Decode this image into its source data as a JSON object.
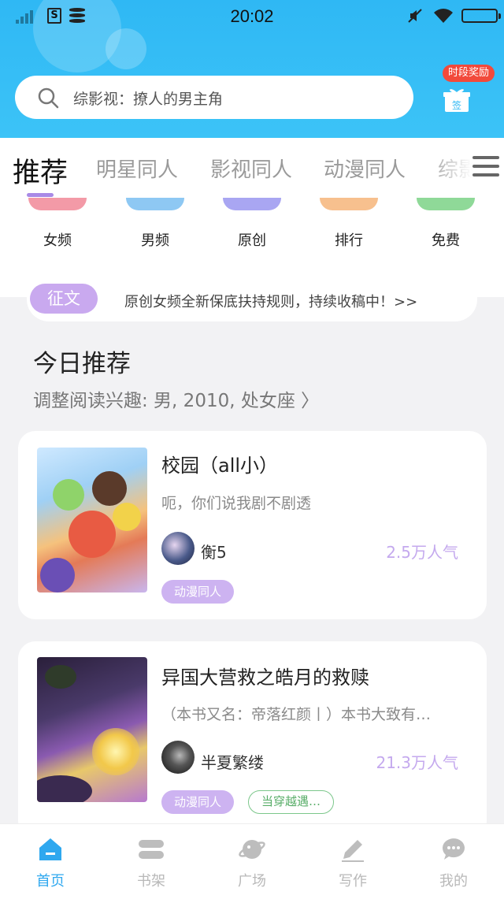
{
  "status_bar": {
    "time": "20:02"
  },
  "search": {
    "placeholder": "综影视：撩人的男主角"
  },
  "reward": {
    "badge": "时段奖励",
    "gift_label": "签"
  },
  "tabs": [
    "推荐",
    "明星同人",
    "影视同人",
    "动漫同人",
    "综影"
  ],
  "categories": [
    {
      "label": "女频",
      "color": "#f39aa7"
    },
    {
      "label": "男频",
      "color": "#8ec8f3"
    },
    {
      "label": "原创",
      "color": "#a9a6f2"
    },
    {
      "label": "排行",
      "color": "#f7c08e"
    },
    {
      "label": "免费",
      "color": "#8fd998"
    }
  ],
  "notice": {
    "tag": "征文",
    "text": "原创女频全新保底扶持规则，持续收稿中！>>"
  },
  "today": {
    "title": "今日推荐",
    "subtitle": "调整阅读兴趣: 男, 2010, 处女座 〉"
  },
  "books": [
    {
      "title": "校园（all小）",
      "desc": "呃，你们说我剧不剧透",
      "author": "衡5",
      "popularity": "2.5万人气",
      "tags": [
        "动漫同人"
      ]
    },
    {
      "title": "异国大营救之皓月的救赎",
      "desc": "（本书又名：帝落红颜丨）本书大致有…",
      "author": "半夏繁缕",
      "popularity": "21.3万人气",
      "tags": [
        "动漫同人",
        "当穿越遇…"
      ]
    }
  ],
  "bottom_nav": [
    {
      "label": "首页",
      "active": true
    },
    {
      "label": "书架"
    },
    {
      "label": "广场"
    },
    {
      "label": "写作"
    },
    {
      "label": "我的"
    }
  ],
  "colors": {
    "primary": "#2fb8f4",
    "accent_purple": "#c9a9ef",
    "active_nav": "#2fa8ef"
  }
}
